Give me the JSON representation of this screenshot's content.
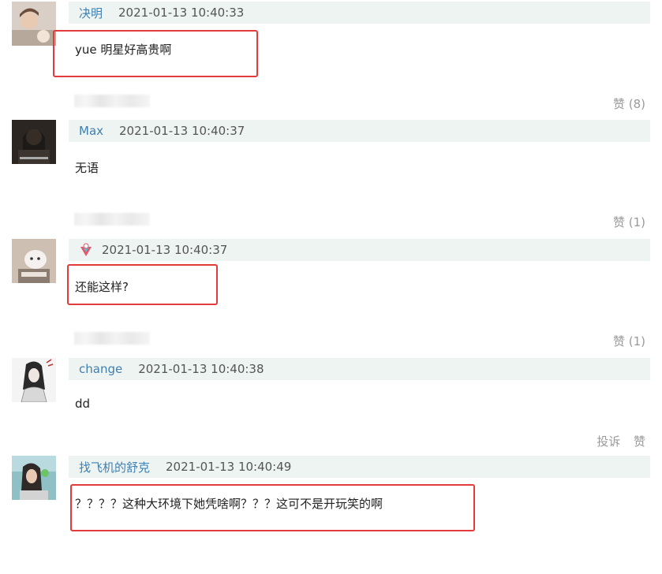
{
  "comments": [
    {
      "username": "决明",
      "time": "2021-01-13 10:40:33",
      "text": "yue 明星好高贵啊",
      "likes": "赞 (8)"
    },
    {
      "username": "Max",
      "time": "2021-01-13 10:40:37",
      "text": "无语",
      "likes": "赞 (1)"
    },
    {
      "username": "",
      "time": "2021-01-13 10:40:37",
      "text": "还能这样?",
      "likes": "赞 (1)"
    },
    {
      "username": "change",
      "time": "2021-01-13 10:40:38",
      "text": "dd",
      "report": "投诉",
      "like": "赞"
    },
    {
      "username": "找飞机的舒克",
      "time": "2021-01-13 10:40:49",
      "text": "？？？？这种大环境下她凭啥啊？？？这可不是开玩笑的啊"
    }
  ],
  "colors": {
    "username": "#3f7fb1",
    "header_bg": "#eef4f1",
    "highlight_box": "#e23b3b"
  }
}
